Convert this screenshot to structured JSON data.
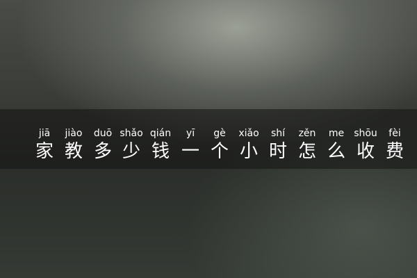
{
  "title": {
    "pinyin": [
      "jiā",
      "jiào",
      "duō",
      "shǎo",
      "qián",
      "yī",
      "gè",
      "xiǎo",
      "shí",
      "zěn",
      "me",
      "shōu",
      "fèi"
    ],
    "hanzi": [
      "家",
      "教",
      "多",
      "少",
      "钱",
      "一",
      "个",
      "小",
      "时",
      "怎",
      "么",
      "收",
      "费"
    ]
  }
}
